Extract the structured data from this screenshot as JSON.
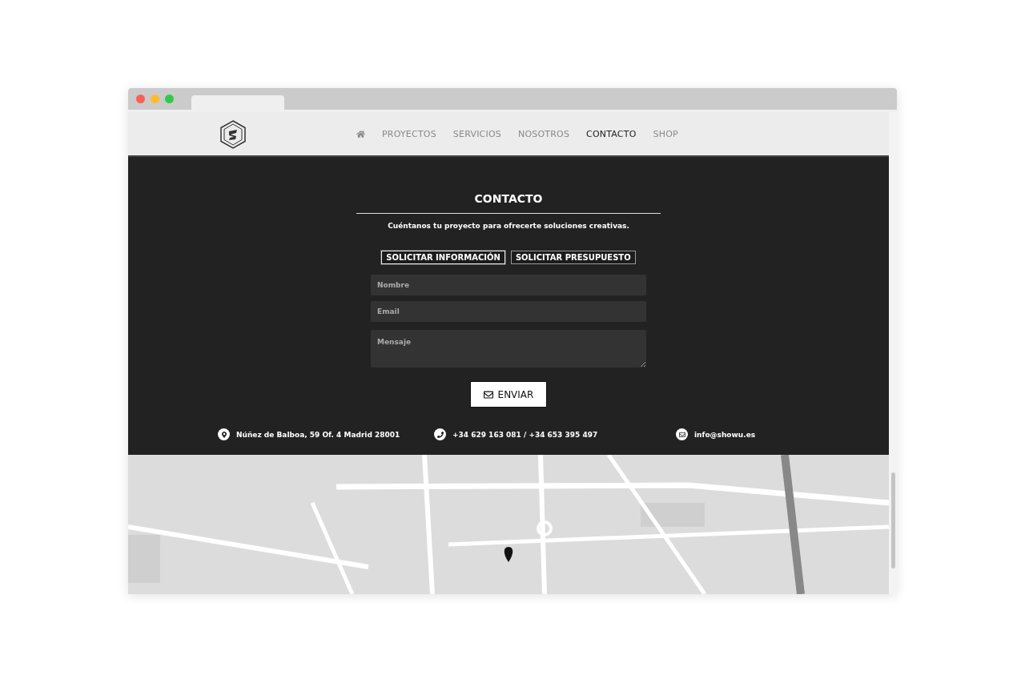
{
  "nav": {
    "items": [
      {
        "kind": "home",
        "selected": false
      },
      {
        "kind": "text",
        "label": "PROYECTOS",
        "selected": false
      },
      {
        "kind": "text",
        "label": "SERVICIOS",
        "selected": false
      },
      {
        "kind": "text",
        "label": "NOSOTROS",
        "selected": false
      },
      {
        "kind": "text",
        "label": "CONTACTO",
        "selected": true
      },
      {
        "kind": "text",
        "label": "SHOP",
        "selected": false
      }
    ]
  },
  "contact": {
    "title": "CONTACTO",
    "subtitle": "Cuéntanos tu proyecto para ofrecerte soluciones creativas.",
    "tabs": [
      {
        "label": "SOLICITAR INFORMACIÓN",
        "selected": true
      },
      {
        "label": "SOLICITAR PRESUPUESTO",
        "selected": false
      }
    ],
    "fields": [
      {
        "kind": "input",
        "placeholder": "Nombre"
      },
      {
        "kind": "input",
        "placeholder": "Email"
      },
      {
        "kind": "textarea",
        "placeholder": "Mensaje"
      }
    ],
    "submit": "ENVIAR",
    "info": [
      {
        "kind": "address",
        "text": "Núñez de Balboa, 59 Of. 4 Madrid 28001"
      },
      {
        "kind": "phone",
        "text": "+34 629 163 081 / +34 653 395 497"
      },
      {
        "kind": "email",
        "text": "info@showu.es"
      }
    ]
  }
}
